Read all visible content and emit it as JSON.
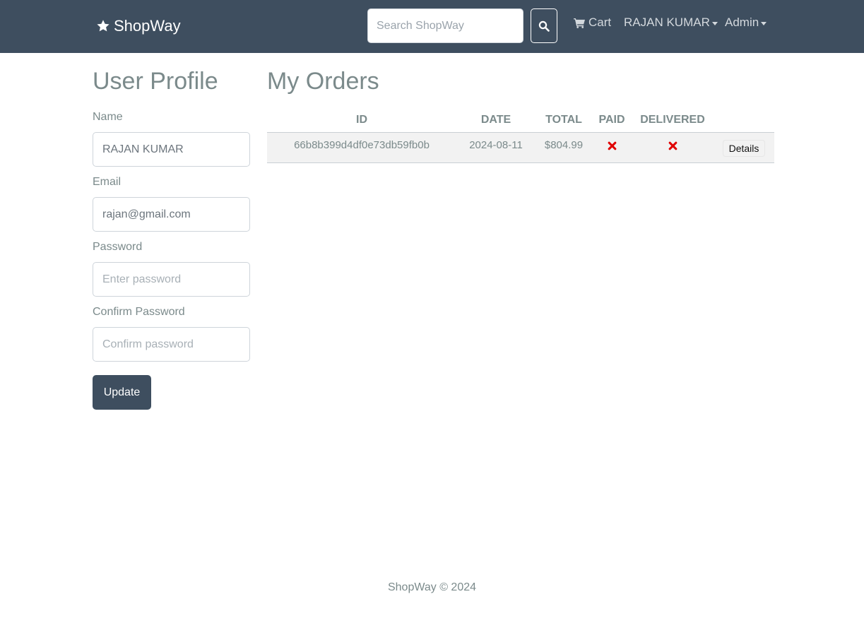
{
  "navbar": {
    "brand": "ShopWay",
    "brand_icon": "star-icon",
    "search_placeholder": "Search ShopWay",
    "search_icon": "search-icon",
    "cart_label": "Cart",
    "cart_icon": "shopping-cart-icon",
    "user_label": "RAJAN KUMAR",
    "admin_label": "Admin",
    "background_color": "#3e4e5f"
  },
  "profile": {
    "title": "User Profile",
    "name_label": "Name",
    "name_value": "RAJAN KUMAR",
    "email_label": "Email",
    "email_value": "rajan@gmail.com",
    "password_label": "Password",
    "password_placeholder": "Enter password",
    "confirm_label": "Confirm Password",
    "confirm_placeholder": "Confirm password",
    "update_label": "Update"
  },
  "orders": {
    "title": "My Orders",
    "columns": [
      "ID",
      "DATE",
      "TOTAL",
      "PAID",
      "DELIVERED",
      ""
    ],
    "rows": [
      {
        "id": "66b8b399d4df0e73db59fb0b",
        "date": "2024-08-11",
        "total": "$804.99",
        "paid": "x-icon",
        "delivered": "x-icon",
        "action_label": "Details"
      }
    ],
    "status_color": "#e00000"
  },
  "footer": {
    "text": "ShopWay © 2024"
  }
}
